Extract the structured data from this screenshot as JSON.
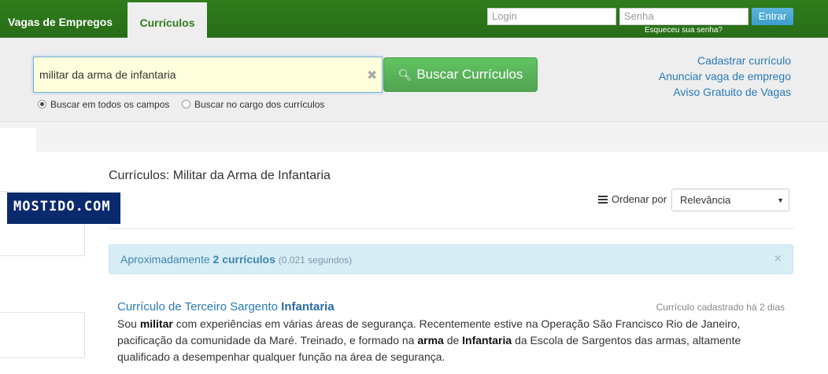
{
  "nav": {
    "tab_jobs": "Vagas de Empregos",
    "tab_resumes": "Currículos"
  },
  "login": {
    "login_placeholder": "Login",
    "password_placeholder": "Senha",
    "submit_label": "Entrar",
    "forgot_link": "Esqueceu sua senha?"
  },
  "search": {
    "query": "militar da arma de infantaria",
    "button_label": "Buscar Currículos",
    "options": [
      {
        "label": "Buscar em todos os campos",
        "selected": true
      },
      {
        "label": "Buscar no cargo dos currículos",
        "selected": false
      }
    ]
  },
  "side_links": [
    "Cadastrar currículo",
    "Anunciar vaga de emprego",
    "Aviso Gratuito de Vagas"
  ],
  "left_logo": "MOSTIDO.COM",
  "main": {
    "title": "Currículos: Militar da Arma de Infantaria",
    "order_label": "Ordenar por",
    "order_value": "Relevância"
  },
  "alert": {
    "prefix": "Aproximadamente",
    "count": "2 currículos",
    "time": "(0,021 segundos)"
  },
  "results": [
    {
      "title_plain": "Currículo de Terceiro Sargento",
      "title_bold": "Infantaria",
      "date": "Currículo cadastrado há 2 dias",
      "desc_parts": [
        "Sou ",
        "militar",
        " com experiências em várias áreas de segurança. Recentemente estive na Operação São Francisco Rio de Janeiro, pacificação da comunidade da Maré. Treinado, e formado na ",
        "arma",
        " de ",
        "Infantaria",
        " da Escola de Sargentos das armas, altamente qualificado a desempenhar qualquer função na área de segurança."
      ]
    }
  ],
  "colors": {
    "topbar": "#2f7d1c",
    "link": "#2a7ab8",
    "search_button": "#51a351",
    "alert_bg": "#d9edf7"
  }
}
